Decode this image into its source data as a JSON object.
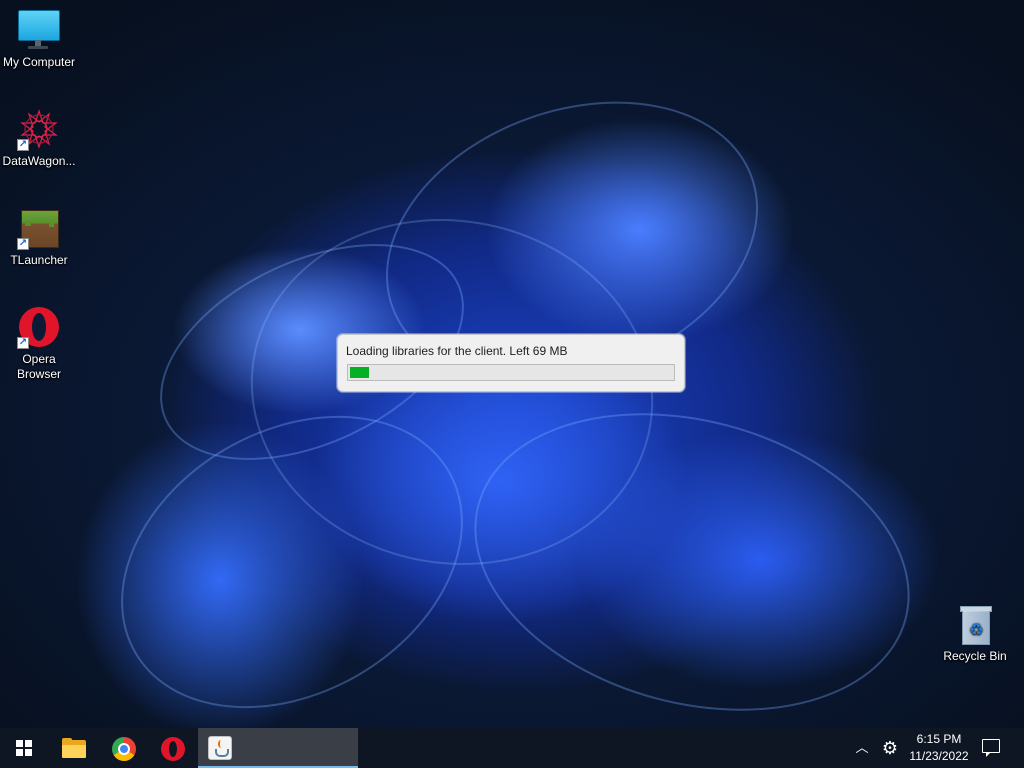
{
  "desktop": {
    "icons": [
      {
        "label": "My Computer",
        "icon": "monitor-icon",
        "shortcut": false
      },
      {
        "label": "DataWagon...",
        "icon": "datawagon-icon",
        "shortcut": true
      },
      {
        "label": "TLauncher",
        "icon": "minecraft-grass-block-icon",
        "shortcut": true
      },
      {
        "label": "Opera Browser",
        "icon": "opera-icon",
        "shortcut": true
      },
      {
        "label": "Recycle Bin",
        "icon": "recycle-bin-icon",
        "shortcut": false
      }
    ]
  },
  "loading_dialog": {
    "message": "Loading libraries for the client. Left 69 MB",
    "progress_fraction": 0.06,
    "progress_color": "#06b025"
  },
  "taskbar": {
    "start_icon": "windows-logo-icon",
    "pinned": [
      {
        "name": "File Explorer",
        "icon": "folder-icon"
      },
      {
        "name": "Google Chrome",
        "icon": "chrome-icon"
      },
      {
        "name": "Opera",
        "icon": "opera-icon"
      },
      {
        "name": "Java",
        "icon": "java-icon",
        "active": true
      }
    ],
    "tray": {
      "chevron_icon": "chevron-up-icon",
      "settings_icon": "gear-icon",
      "time": "6:15 PM",
      "date": "11/23/2022",
      "notification_icon": "notification-icon"
    },
    "accent_color": "#76b9ed"
  }
}
